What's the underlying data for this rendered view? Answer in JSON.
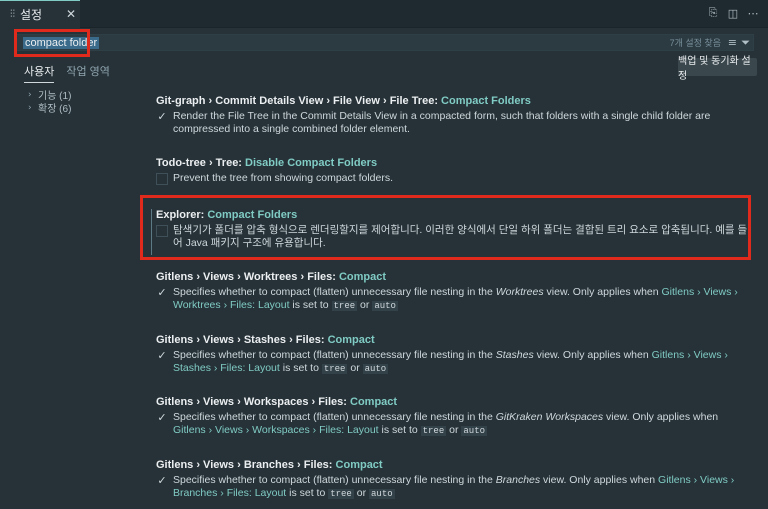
{
  "tab": {
    "icon": "settings-sliders-icon",
    "label": "설정",
    "close": "✕"
  },
  "toolbar": {
    "open_json_icon": "open-json-icon",
    "split_icon": "split-editor-icon",
    "more_icon": "more-actions-icon"
  },
  "search": {
    "value": "compact folder",
    "result_count": "7개 설정 찾음",
    "clear_icon": "clear-filter-icon",
    "filter_icon": "filter-icon"
  },
  "scope": {
    "user": "사용자",
    "workspace": "작업 영역"
  },
  "backup_button": "백업 및 동기화 설정",
  "toc": [
    {
      "label": "기능 (1)"
    },
    {
      "label": "확장 (6)"
    }
  ],
  "settings": [
    {
      "prefix": "Git-graph › Commit Details View › File View › File Tree: ",
      "name": "Compact Folders",
      "checked": true,
      "description": "Render the File Tree in the Commit Details View in a compacted form, such that folders with a single child folder are compressed into a single combined folder element."
    },
    {
      "prefix": "Todo-tree › Tree: ",
      "name": "Disable Compact Folders",
      "checked": false,
      "description": "Prevent the tree from showing compact folders."
    },
    {
      "prefix": "Explorer: ",
      "name": "Compact Folders",
      "checked": false,
      "description": "탐색기가 폴더를 압축 형식으로 렌더링할지를 제어합니다. 이러한 양식에서 단일 하위 폴더는 결합된 트리 요소로 압축됩니다. 예를 들어 Java 패키지 구조에 유용합니다."
    },
    {
      "prefix": "Gitlens › Views › Worktrees › Files: ",
      "name": "Compact",
      "checked": true,
      "desc_a": "Specifies whether to compact (flatten) unnecessary file nesting in the ",
      "desc_view": "Worktrees",
      "desc_b": " view. Only applies when ",
      "desc_link": "Gitlens › Views › Worktrees › Files: Layout",
      "desc_c": " is set to ",
      "code1": "tree",
      "desc_or": " or ",
      "code2": "auto"
    },
    {
      "prefix": "Gitlens › Views › Stashes › Files: ",
      "name": "Compact",
      "checked": true,
      "desc_a": "Specifies whether to compact (flatten) unnecessary file nesting in the ",
      "desc_view": "Stashes",
      "desc_b": " view. Only applies when ",
      "desc_link": "Gitlens › Views › Stashes › Files: Layout",
      "desc_c": " is set to ",
      "code1": "tree",
      "desc_or": " or ",
      "code2": "auto"
    },
    {
      "prefix": "Gitlens › Views › Workspaces › Files: ",
      "name": "Compact",
      "checked": true,
      "desc_a": "Specifies whether to compact (flatten) unnecessary file nesting in the ",
      "desc_view": "GitKraken Workspaces",
      "desc_b": " view. Only applies when ",
      "desc_link": "Gitlens › Views › Workspaces › Files: Layout",
      "desc_c": " is set to ",
      "code1": "tree",
      "desc_or": " or ",
      "code2": "auto"
    },
    {
      "prefix": "Gitlens › Views › Branches › Files: ",
      "name": "Compact",
      "checked": true,
      "desc_a": "Specifies whether to compact (flatten) unnecessary file nesting in the ",
      "desc_view": "Branches",
      "desc_b": " view. Only applies when ",
      "desc_link": "Gitlens › Views › Branches › Files: Layout",
      "desc_c": " is set to ",
      "code1": "tree",
      "desc_or": " or ",
      "code2": "auto"
    }
  ],
  "colors": {
    "accent": "#80cbc4",
    "highlight_border": "#e02a1b",
    "background": "#263238"
  }
}
